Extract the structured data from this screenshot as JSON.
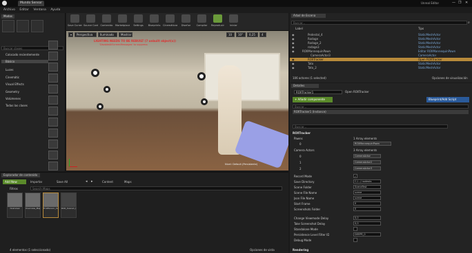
{
  "titlebar": {
    "window_tab": "Mundo Sensor",
    "right_label": "Unreal Editor",
    "min": "—",
    "max": "❐",
    "close": "✕"
  },
  "menu": [
    "Archivo",
    "Editar",
    "Ventana",
    "Ayuda"
  ],
  "modes": {
    "title": "Modos",
    "search_placeholder": "Buscar clases",
    "categories": [
      "Colocado recientemente",
      "Básico",
      "Luces",
      "Cinemátic",
      "Visual Effects",
      "Geometry",
      "Volúmenes",
      "Todas las clases"
    ]
  },
  "toolbar": {
    "buttons": [
      "Save Current",
      "Source Control",
      "Contenido",
      "Marketplace",
      "Settings",
      "Blueprints",
      "Cinemáticas",
      "Diseñar",
      "Compilar",
      "Reproducir",
      "Iniciar"
    ]
  },
  "viewport": {
    "perspective": "Perspectiva",
    "lit": "Iluminado",
    "show": "Mostrar",
    "warning": "LIGHTING NEEDS TO BE REBUILT (7 unbuilt object(s))",
    "warning2": "'DisableAllScreenMessages' to suppress",
    "grid": "10",
    "angle": "10°",
    "scale": "0,25",
    "cam": "4",
    "level": "Nivel: Default (Persistente)"
  },
  "outliner": {
    "title": "Árbol de Escena",
    "search_placeholder": "Buscar...",
    "col_label": "Label",
    "col_type": "Tipo",
    "rows": [
      {
        "label": "Pedestal_4",
        "type": "StaticMeshActor"
      },
      {
        "label": "Rodage",
        "type": "StaticMeshActor"
      },
      {
        "label": "Rodage_2",
        "type": "StaticMeshActor"
      },
      {
        "label": "rodage3",
        "type": "StaticMeshActor"
      },
      {
        "label": "ROXMannequinPawn",
        "type": "Editar ROXMannequinPawn"
      },
      {
        "label": "CameraActor3",
        "type": "CameraActor"
      },
      {
        "label": "ROXTracker",
        "type": "Open ROXTracker"
      },
      {
        "label": "Tato",
        "type": "StaticMeshActor"
      },
      {
        "label": "Tato_2",
        "type": "StaticMeshActor"
      }
    ],
    "footer": "106 actores (1 selected)",
    "view_options": "Opciones de visualización"
  },
  "details": {
    "title": "Detalles",
    "actor_name": "ROXTracker1",
    "open_label": "Open ROXTracker",
    "add_component": "+ Añadir componente",
    "blueprint_button": "Blueprint/Add Script",
    "search_placeholder": "Buscar...",
    "instance": "ROXTracker1 (Instance)",
    "section": "ROXTracker",
    "props": [
      {
        "label": "Pawns",
        "value": "1 Array elements"
      },
      {
        "label": "0",
        "value": "ROXMannequinPawn"
      },
      {
        "label": "Camera Actors",
        "value": "3 Array elements"
      },
      {
        "label": "0",
        "value": "CameraActor"
      },
      {
        "label": "1",
        "value": "CameraActor2"
      },
      {
        "label": "2",
        "value": "CameraActor3"
      },
      {
        "label": "Record Mode",
        "value": "✓"
      },
      {
        "label": "Save Directory",
        "value": "C:/.../ roxtests"
      },
      {
        "label": "Scene Folder",
        "value": "SceneTest"
      },
      {
        "label": "Scene File Name",
        "value": "scene"
      },
      {
        "label": "Json File Name",
        "value": "scene"
      },
      {
        "label": "Start Frame",
        "value": "0"
      },
      {
        "label": "Screenshots Folder",
        "value": "0"
      },
      {
        "label": "Change Viewmode Delay",
        "value": "0,0"
      },
      {
        "label": "Take Screenshot Delay",
        "value": "0,0"
      },
      {
        "label": "Standalone Mode",
        "value": ""
      },
      {
        "label": "Persistence Level Filter ID",
        "value": "DEEPR_0"
      },
      {
        "label": "Debug Mode",
        "value": ""
      }
    ],
    "footer_section": "Rendering"
  },
  "content": {
    "title": "Explorador de contenido",
    "add_new": "Add New",
    "import": "Importar",
    "save_all": "Save All",
    "path": [
      "Content",
      "Maps"
    ],
    "filters": "Filtros",
    "search_placeholder": "Search Maps",
    "assets": [
      "Overview",
      "Overview_MapBuild",
      "FirstPerson_ScriptData",
      "ROX_Scene1_BuiltData",
      "MapBuild_Data_A"
    ],
    "footer": "4 elementos (1 seleccionado)",
    "view_options": "Opciones de vista"
  }
}
